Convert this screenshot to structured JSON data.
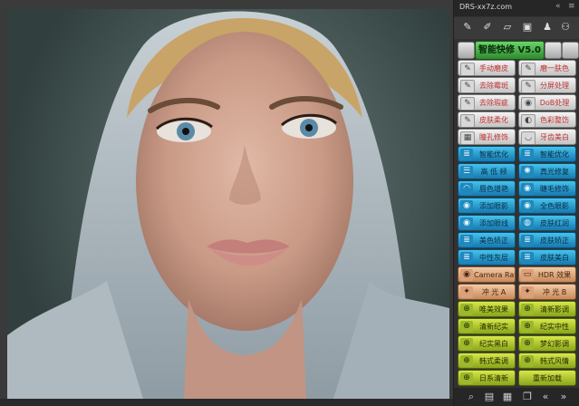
{
  "panel": {
    "title": "DRS-xx7z.com",
    "header_icons": [
      "collapse-icon",
      "menu-icon"
    ],
    "toolbar_icons": [
      "eyedropper-icon",
      "brush-icon",
      "ruler-icon",
      "chip-icon",
      "person-icon",
      "people-icon"
    ],
    "main_title": "智能快修 V5.0",
    "rows": [
      {
        "style": "grey",
        "left": {
          "label": "手动磨皮",
          "icon": "brush-icon"
        },
        "right": {
          "label": "磨一肤色",
          "icon": "brush-icon"
        }
      },
      {
        "style": "grey",
        "left": {
          "label": "去除霉斑",
          "icon": "brush-icon"
        },
        "right": {
          "label": "分屏处理",
          "icon": "brush-icon"
        }
      },
      {
        "style": "grey",
        "left": {
          "label": "去除瑕疵",
          "icon": "brush-icon"
        },
        "right": {
          "label": "DoB处理",
          "icon": "camera-icon"
        }
      },
      {
        "style": "grey",
        "left": {
          "label": "皮肤柔化",
          "icon": "brush-icon"
        },
        "right": {
          "label": "色彩整饬",
          "icon": "palette-icon"
        }
      },
      {
        "style": "grey",
        "left": {
          "label": "瞳孔修饰",
          "icon": "grid-icon"
        },
        "right": {
          "label": "牙齿美白",
          "icon": "tooth-icon"
        }
      },
      {
        "style": "blue",
        "left": {
          "label": "智能优化",
          "icon": "layers-icon"
        },
        "right": {
          "label": "智能优化",
          "icon": "layers-icon"
        }
      },
      {
        "style": "blue",
        "left": {
          "label": "高 低 频",
          "icon": "list-icon"
        },
        "right": {
          "label": "真光修复",
          "icon": "sun-icon"
        }
      },
      {
        "style": "blue",
        "left": {
          "label": "唇色增艳",
          "icon": "lips-icon"
        },
        "right": {
          "label": "睫毛修饰",
          "icon": "eye-icon"
        }
      },
      {
        "style": "blue",
        "left": {
          "label": "添加眼影",
          "icon": "eye-icon"
        },
        "right": {
          "label": "全色眼影",
          "icon": "eye-icon"
        }
      },
      {
        "style": "blue",
        "left": {
          "label": "添加眼线",
          "icon": "eye-icon"
        },
        "right": {
          "label": "皮肤红润",
          "icon": "drop-icon"
        }
      },
      {
        "style": "blue",
        "left": {
          "label": "美色矫正",
          "icon": "layers-icon"
        },
        "right": {
          "label": "皮肤矫正",
          "icon": "layers-icon"
        }
      },
      {
        "style": "blue",
        "left": {
          "label": "中性灰层",
          "icon": "layers-icon"
        },
        "right": {
          "label": "皮肤美白",
          "icon": "layers-icon"
        }
      },
      {
        "style": "tan",
        "left": {
          "label": "Camera Raw",
          "icon": "camera-icon"
        },
        "right": {
          "label": "HDR 效果",
          "icon": "frame-icon"
        }
      },
      {
        "style": "tan",
        "left": {
          "label": "冲 光 A",
          "icon": "light-icon"
        },
        "right": {
          "label": "冲 光 B",
          "icon": "light-icon"
        }
      },
      {
        "style": "green",
        "left": {
          "label": "唯美效果",
          "icon": "globe-icon"
        },
        "right": {
          "label": "清新影调",
          "icon": "globe-icon"
        }
      },
      {
        "style": "green",
        "left": {
          "label": "清新纪实",
          "icon": "globe-icon"
        },
        "right": {
          "label": "纪实中性",
          "icon": "globe-icon"
        }
      },
      {
        "style": "green",
        "left": {
          "label": "纪实黑白",
          "icon": "globe-icon"
        },
        "right": {
          "label": "梦幻影调",
          "icon": "globe-icon"
        }
      },
      {
        "style": "green",
        "left": {
          "label": "韩式柔调",
          "icon": "globe-icon"
        },
        "right": {
          "label": "韩式风情",
          "icon": "globe-icon"
        }
      },
      {
        "style": "green",
        "left": {
          "label": "日系清新",
          "icon": "globe-icon"
        },
        "right": {
          "label": "重新加载",
          "icon": ""
        }
      }
    ],
    "footer_icons": [
      "search-icon",
      "film-icon",
      "grid-icon",
      "copy-icon",
      "rewind-icon",
      "forward-icon"
    ]
  }
}
